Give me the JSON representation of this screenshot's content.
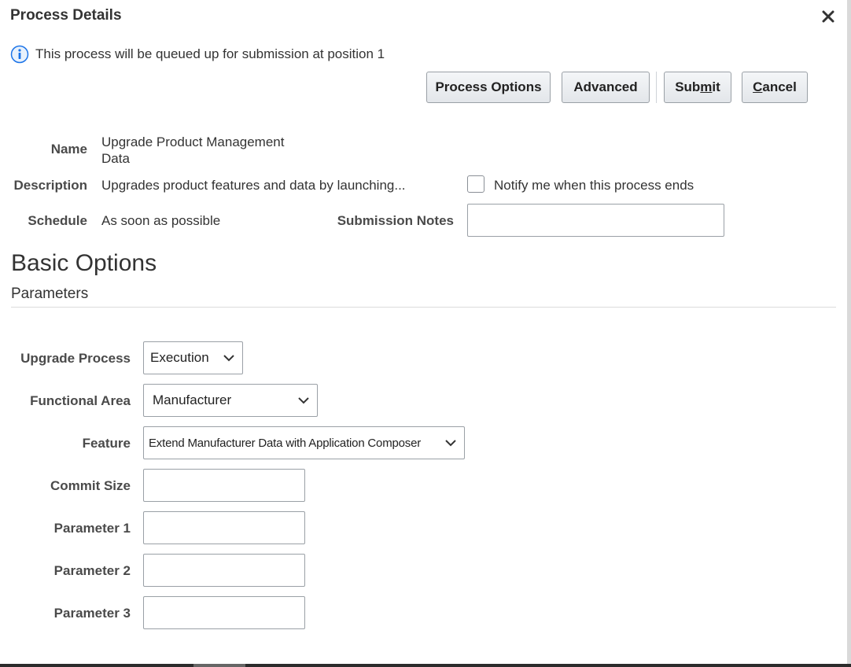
{
  "dialog": {
    "title": "Process Details",
    "info_message": "This process will be queued up for submission at position 1"
  },
  "buttons": {
    "process_options": "Process Options",
    "advanced": "Advanced",
    "submit": {
      "before": "Sub",
      "mnemonic": "m",
      "after": "it"
    },
    "cancel": {
      "before": "",
      "mnemonic": "C",
      "after": "ancel"
    }
  },
  "details": {
    "name_label": "Name",
    "name_line1": "Upgrade Product Management",
    "name_line2": "Data",
    "description_label": "Description",
    "description_value": "Upgrades product features and data by launching...",
    "notify_label": "Notify me when this process ends",
    "notify_checked": false,
    "schedule_label": "Schedule",
    "schedule_value": "As soon as possible",
    "submission_notes_label": "Submission Notes",
    "submission_notes_value": ""
  },
  "basic_options": {
    "title": "Basic Options",
    "subheading": "Parameters",
    "upgrade_process": {
      "label": "Upgrade Process",
      "value": "Execution"
    },
    "functional_area": {
      "label": "Functional Area",
      "value": "Manufacturer"
    },
    "feature": {
      "label": "Feature",
      "value": "Extend Manufacturer Data with Application Composer"
    },
    "commit_size": {
      "label": "Commit Size",
      "value": ""
    },
    "parameter_1": {
      "label": "Parameter 1",
      "value": ""
    },
    "parameter_2": {
      "label": "Parameter 2",
      "value": ""
    },
    "parameter_3": {
      "label": "Parameter 3",
      "value": ""
    }
  },
  "icons": {
    "info": "info-icon",
    "close": "close-icon",
    "dropdown": "chevron-down-icon"
  },
  "colors": {
    "info_blue": "#1a73e8",
    "button_border": "#9aa0a6"
  }
}
